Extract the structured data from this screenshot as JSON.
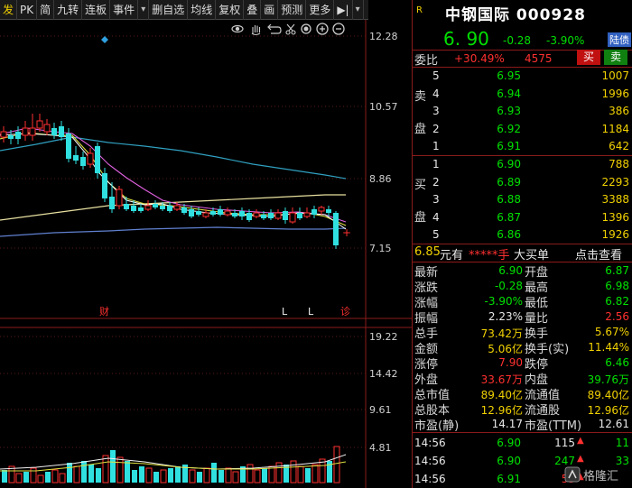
{
  "toolbar": {
    "items": [
      "发",
      "PK",
      "简",
      "九转",
      "连板",
      "事件",
      "▾",
      "删自选",
      "均线",
      "复权",
      "叠",
      "画",
      "预测",
      "更多",
      "▶|",
      "▾"
    ]
  },
  "chart": {
    "price_axis": [
      "12.28",
      "10.57",
      "8.86",
      "7.15"
    ],
    "volume_axis": [
      "19.22",
      "14.42",
      "9.61",
      "4.81"
    ],
    "markers": {
      "cai": "财",
      "l1": "L",
      "l2": "L",
      "zhen": "诊"
    },
    "tool_icons": [
      "eye-icon",
      "hand-icon",
      "undo-icon",
      "scissors-icon",
      "settings-icon",
      "zoom-in-icon",
      "zoom-out-icon"
    ]
  },
  "stock": {
    "market_tag": "R",
    "name": "中钢国际",
    "code": "000928",
    "price": "6. 90",
    "change": "-0.28",
    "change_pct": "-3.90%",
    "tag": "陆债"
  },
  "webi": {
    "label": "委比",
    "pct": "+30.49%",
    "diff": "4575",
    "buy": "买",
    "sell": "卖"
  },
  "sell_label": [
    "卖",
    "盘"
  ],
  "buy_label": [
    "买",
    "盘"
  ],
  "sell_orders": [
    {
      "level": "5",
      "price": "6.95",
      "vol": "1007"
    },
    {
      "level": "4",
      "price": "6.94",
      "vol": "1996"
    },
    {
      "level": "3",
      "price": "6.93",
      "vol": "386"
    },
    {
      "level": "2",
      "price": "6.92",
      "vol": "1184"
    },
    {
      "level": "1",
      "price": "6.91",
      "vol": "642"
    }
  ],
  "buy_orders": [
    {
      "level": "1",
      "price": "6.90",
      "vol": "788"
    },
    {
      "level": "2",
      "price": "6.89",
      "vol": "2293"
    },
    {
      "level": "3",
      "price": "6.88",
      "vol": "3388"
    },
    {
      "level": "4",
      "price": "6.87",
      "vol": "1396"
    },
    {
      "level": "5",
      "price": "6.86",
      "vol": "1926"
    }
  ],
  "big_order": {
    "price": "6.85",
    "unit": "元有",
    "stars": "*****手",
    "text": "大买单",
    "link": "点击查看"
  },
  "stats": [
    {
      "l1": "最新",
      "v1": "6.90",
      "c1": "green",
      "l2": "开盘",
      "v2": "6.87",
      "c2": "green"
    },
    {
      "l1": "涨跌",
      "v1": "-0.28",
      "c1": "green",
      "l2": "最高",
      "v2": "6.98",
      "c2": "green"
    },
    {
      "l1": "涨幅",
      "v1": "-3.90%",
      "c1": "green",
      "l2": "最低",
      "v2": "6.82",
      "c2": "green"
    },
    {
      "l1": "振幅",
      "v1": "2.23%",
      "c1": "white",
      "l2": "量比",
      "v2": "2.56",
      "c2": "red"
    },
    {
      "l1": "总手",
      "v1": "73.42万",
      "c1": "yellow",
      "l2": "换手",
      "v2": "5.67%",
      "c2": "yellow"
    },
    {
      "l1": "金额",
      "v1": "5.06亿",
      "c1": "yellow",
      "l2": "换手(实)",
      "v2": "11.44%",
      "c2": "yellow"
    },
    {
      "l1": "涨停",
      "v1": "7.90",
      "c1": "red",
      "l2": "跌停",
      "v2": "6.46",
      "c2": "green"
    },
    {
      "l1": "外盘",
      "v1": "33.67万",
      "c1": "red",
      "l2": "内盘",
      "v2": "39.76万",
      "c2": "green"
    },
    {
      "l1": "总市值",
      "v1": "89.40亿",
      "c1": "yellow",
      "l2": "流通值",
      "v2": "89.40亿",
      "c2": "yellow"
    },
    {
      "l1": "总股本",
      "v1": "12.96亿",
      "c1": "yellow",
      "l2": "流通股",
      "v2": "12.96亿",
      "c2": "yellow"
    },
    {
      "l1": "市盈(静)",
      "v1": "14.17",
      "c1": "white",
      "l2": "市盈(TTM)",
      "v2": "12.61",
      "c2": "white"
    }
  ],
  "ticks": [
    {
      "time": "14:56",
      "price": "6.90",
      "vol": "115",
      "arrow": "▲",
      "count": "11",
      "pc": "green",
      "vc": "white"
    },
    {
      "time": "14:56",
      "price": "6.90",
      "vol": "247",
      "arrow": "▲",
      "count": "33",
      "pc": "green",
      "vc": "green"
    },
    {
      "time": "14:56",
      "price": "6.91",
      "vol": "55",
      "arrow": "▲",
      "count": "",
      "pc": "green",
      "vc": "red"
    }
  ],
  "watermark": "格隆汇"
}
